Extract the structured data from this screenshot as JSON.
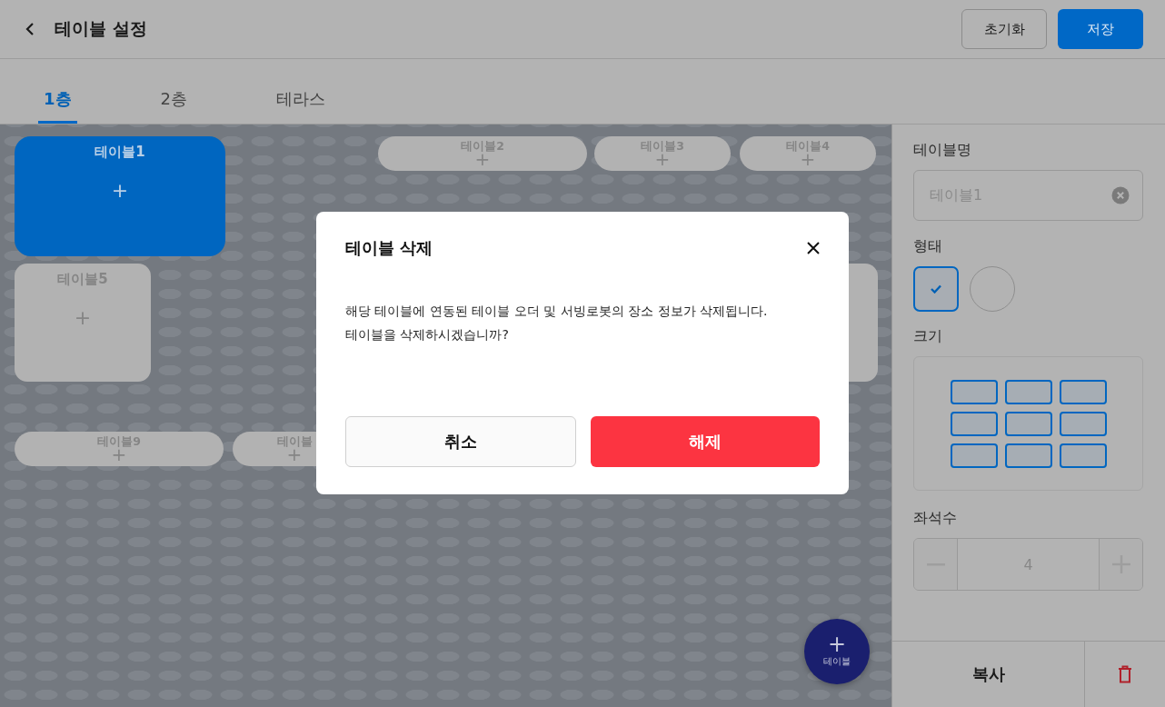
{
  "header": {
    "title": "테이블 설정",
    "buttons": [
      {
        "label": "초기화",
        "kind": "secondary"
      },
      {
        "label": "저장",
        "kind": "primary"
      }
    ]
  },
  "tabs": [
    {
      "label": "1층",
      "selected": true
    },
    {
      "label": "2층",
      "selected": false
    },
    {
      "label": "테라스",
      "selected": false
    }
  ],
  "tables": [
    {
      "label": "테이블1",
      "selected": true,
      "plus": "+"
    },
    {
      "label": "테이블2",
      "selected": false,
      "plus": "+"
    },
    {
      "label": "테이블3",
      "selected": false,
      "plus": "+"
    },
    {
      "label": "테이블4",
      "selected": false,
      "plus": "+"
    },
    {
      "label": "테이블5",
      "selected": false,
      "plus": "+"
    },
    {
      "label": "테이블9",
      "selected": false,
      "plus": "+"
    },
    {
      "label": "테이블",
      "selected": false,
      "plus": "+"
    }
  ],
  "fab": {
    "plus": "+",
    "label": "테이블"
  },
  "panel": {
    "name_label": "테이블명",
    "name_value": "테이블1",
    "shape_label": "형태",
    "shapes": [
      {
        "kind": "square",
        "selected": true
      },
      {
        "kind": "circle",
        "selected": false
      }
    ],
    "size_label": "크기",
    "seats_label": "좌석수",
    "seats_value": "4",
    "copy_button": "복사"
  },
  "dialog": {
    "title": "테이블 삭제",
    "message": "해당 테이블에 연동된 테이블 오더 및 서빙로봇의 장소 정보가 삭제됩니다.\n테이블을 삭제하시겠습니까?",
    "buttons": [
      {
        "label": "취소",
        "kind": "cancel"
      },
      {
        "label": "해제",
        "kind": "danger"
      }
    ]
  }
}
